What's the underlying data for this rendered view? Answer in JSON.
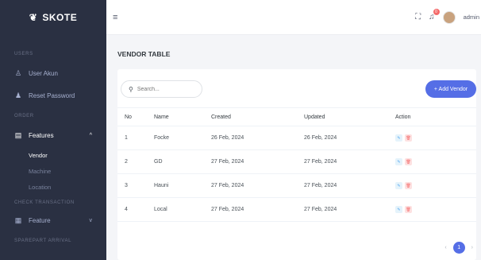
{
  "brand": {
    "logo_icon": "leaf-icon",
    "name": "SKOTE"
  },
  "sidebar": {
    "sections": {
      "users": "USERS",
      "order": "ORDER",
      "check_transaction": "CHECK TRANSACTION",
      "sparepart_arrival": "SPAREPART ARRIVAL"
    },
    "items": {
      "user_akun": "User Akun",
      "reset_password": "Reset Password",
      "features": "Features",
      "feature": "Feature"
    },
    "sub_items": [
      "Vendor",
      "Machine",
      "Location"
    ]
  },
  "topbar": {
    "username": "admin",
    "notification_count": "0"
  },
  "page": {
    "title": "VENDOR TABLE"
  },
  "search": {
    "placeholder": "Search..."
  },
  "add_button": {
    "label": "+ Add Vendor"
  },
  "table": {
    "headers": [
      "No",
      "Name",
      "Created",
      "Updated",
      "Action"
    ],
    "rows": [
      [
        "1",
        "Focke",
        "26 Feb, 2024",
        "26 Feb, 2024"
      ],
      [
        "2",
        "GD",
        "27 Feb, 2024",
        "27 Feb, 2024"
      ],
      [
        "3",
        "Hauni",
        "27 Feb, 2024",
        "27 Feb, 2024"
      ],
      [
        "4",
        "Local",
        "27 Feb, 2024",
        "27 Feb, 2024"
      ]
    ]
  },
  "pagination": {
    "current": "1"
  },
  "colors": {
    "sidebar": "#2a3042",
    "accent": "#556ee6",
    "danger": "#f46a6a",
    "info": "#50a5f1"
  }
}
